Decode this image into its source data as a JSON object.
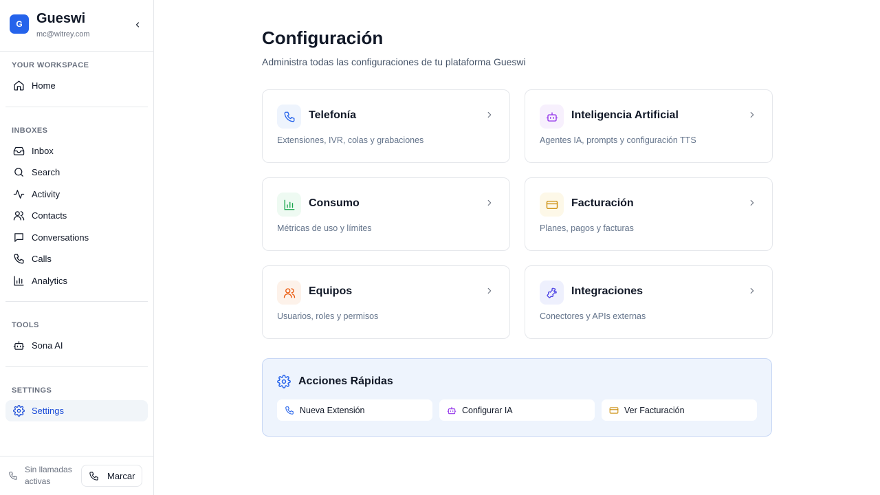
{
  "workspace": {
    "initial": "G",
    "name": "Gueswi",
    "email": "mc@witrey.com"
  },
  "sidebar": {
    "sections": [
      {
        "title": "YOUR WORKSPACE",
        "items": [
          {
            "label": "Home",
            "icon": "home-icon"
          }
        ]
      },
      {
        "title": "INBOXES",
        "items": [
          {
            "label": "Inbox",
            "icon": "inbox-icon"
          },
          {
            "label": "Search",
            "icon": "search-icon"
          },
          {
            "label": "Activity",
            "icon": "activity-icon"
          },
          {
            "label": "Contacts",
            "icon": "users-icon"
          },
          {
            "label": "Conversations",
            "icon": "message-icon"
          },
          {
            "label": "Calls",
            "icon": "phone-icon"
          },
          {
            "label": "Analytics",
            "icon": "bar-chart-icon"
          }
        ]
      },
      {
        "title": "TOOLS",
        "items": [
          {
            "label": "Sona AI",
            "icon": "bot-icon"
          }
        ]
      },
      {
        "title": "SETTINGS",
        "items": [
          {
            "label": "Settings",
            "icon": "gear-icon",
            "active": true
          }
        ]
      }
    ],
    "footer": {
      "status": "Sin llamadas activas",
      "dial_label": "Marcar"
    }
  },
  "page": {
    "title": "Configuración",
    "subtitle": "Administra todas las configuraciones de tu plataforma Gueswi"
  },
  "cards": [
    {
      "title": "Telefonía",
      "desc": "Extensiones, IVR, colas y grabaciones",
      "icon": "phone-icon",
      "color": "#2563eb",
      "bg": "#eef4fd"
    },
    {
      "title": "Inteligencia Artificial",
      "desc": "Agentes IA, prompts y configuración TTS",
      "icon": "bot-icon",
      "color": "#9333ea",
      "bg": "#f7f0fd"
    },
    {
      "title": "Consumo",
      "desc": "Métricas de uso y límites",
      "icon": "bar-chart-icon",
      "color": "#16a34a",
      "bg": "#eefaf2"
    },
    {
      "title": "Facturación",
      "desc": "Planes, pagos y facturas",
      "icon": "credit-card-icon",
      "color": "#ca8a04",
      "bg": "#fdf8e8"
    },
    {
      "title": "Equipos",
      "desc": "Usuarios, roles y permisos",
      "icon": "users-icon",
      "color": "#ea580c",
      "bg": "#fdf2ea"
    },
    {
      "title": "Integraciones",
      "desc": "Conectores y APIs externas",
      "icon": "puzzle-icon",
      "color": "#4f46e5",
      "bg": "#eef0fd"
    }
  ],
  "quick_actions": {
    "title": "Acciones Rápidas",
    "buttons": [
      {
        "label": "Nueva Extensión",
        "icon": "phone-icon",
        "color": "#2563eb"
      },
      {
        "label": "Configurar IA",
        "icon": "bot-icon",
        "color": "#9333ea"
      },
      {
        "label": "Ver Facturación",
        "icon": "credit-card-icon",
        "color": "#ca8a04"
      }
    ]
  },
  "colors": {
    "accent": "#2563eb",
    "active_nav_text": "#1d4ed8",
    "border": "#e5e7eb"
  }
}
